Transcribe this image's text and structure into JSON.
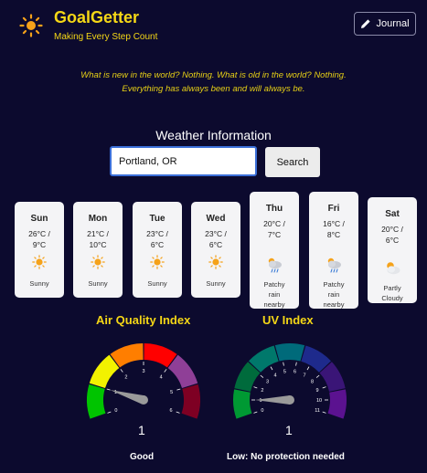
{
  "header": {
    "title": "GoalGetter",
    "subtitle": "Making Every Step Count",
    "journal_label": "Journal",
    "accent": "#f5d716"
  },
  "quote": {
    "line1": "What is new in the world? Nothing. What is old in the world? Nothing.",
    "line2": "Everything has always been and will always be."
  },
  "weather": {
    "title": "Weather Information",
    "search_value": "Portland, OR",
    "search_button": "Search",
    "days": [
      {
        "name": "Sun",
        "temp1": "26°C /",
        "temp2": "9°C",
        "condition": [
          "Sunny"
        ],
        "icon": "sun-icon"
      },
      {
        "name": "Mon",
        "temp1": "21°C /",
        "temp2": "10°C",
        "condition": [
          "Sunny"
        ],
        "icon": "sun-icon"
      },
      {
        "name": "Tue",
        "temp1": "23°C /",
        "temp2": "6°C",
        "condition": [
          "Sunny"
        ],
        "icon": "sun-icon"
      },
      {
        "name": "Wed",
        "temp1": "23°C /",
        "temp2": "6°C",
        "condition": [
          "Sunny"
        ],
        "icon": "sun-icon"
      },
      {
        "name": "Thu",
        "temp1": "20°C /",
        "temp2": "7°C",
        "condition": [
          "Patchy",
          "rain",
          "nearby"
        ],
        "icon": "patchy-rain-icon"
      },
      {
        "name": "Fri",
        "temp1": "16°C /",
        "temp2": "8°C",
        "condition": [
          "Patchy",
          "rain",
          "nearby"
        ],
        "icon": "patchy-rain-icon"
      },
      {
        "name": "Sat",
        "temp1": "20°C /",
        "temp2": "6°C",
        "condition": [
          "Partly",
          "Cloudy"
        ],
        "icon": "partly-cloudy-icon"
      }
    ]
  },
  "air_quality": {
    "title": "Air Quality Index",
    "value": "1",
    "level": 1,
    "max": 6,
    "status": "Good",
    "ticks": [
      "0",
      "1",
      "2",
      "3",
      "4",
      "5",
      "6"
    ],
    "colors": [
      "#00c400",
      "#f2f200",
      "#ff7e00",
      "#ff0000",
      "#8f3f97",
      "#7e0023"
    ]
  },
  "uv_index": {
    "title": "UV Index",
    "value": "1",
    "level": 1,
    "max": 11,
    "status": "Low: No protection needed",
    "ticks": [
      "0",
      "1",
      "2",
      "3",
      "4",
      "5",
      "6",
      "7",
      "8",
      "9",
      "10",
      "11"
    ],
    "colors": [
      "#009933",
      "#006b3c",
      "#00786b",
      "#006a7a",
      "#1e2a8c",
      "#3a1577",
      "#5b1290"
    ]
  }
}
